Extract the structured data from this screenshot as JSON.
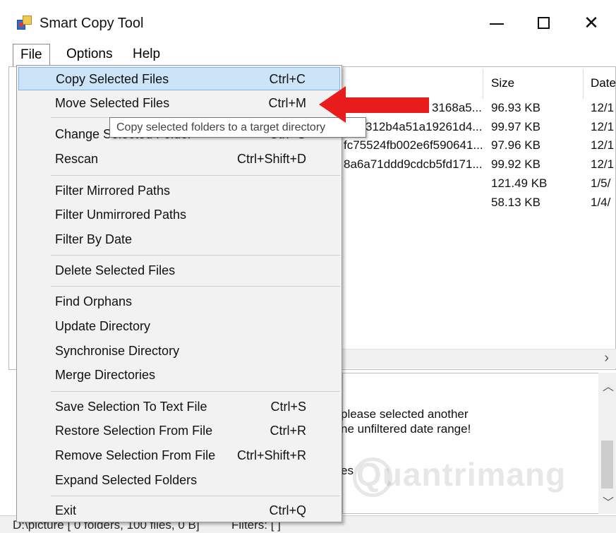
{
  "window": {
    "title": "Smart Copy Tool"
  },
  "menubar": {
    "file": "File",
    "options": "Options",
    "help": "Help"
  },
  "list": {
    "columns": {
      "size": "Size",
      "date": "Date"
    },
    "rows": [
      {
        "name": "3168a5...",
        "size": "96.93 KB",
        "date": "12/1"
      },
      {
        "name": "312b4a51a19261d4...",
        "size": "99.97 KB",
        "date": "12/1"
      },
      {
        "name": "fc75524fb002e6f590641...",
        "size": "97.96 KB",
        "date": "12/1"
      },
      {
        "name": "8a6a71ddd9cdcb5fd171...",
        "size": "99.92 KB",
        "date": "12/1"
      },
      {
        "name": "",
        "size": "121.49 KB",
        "date": "1/5/"
      },
      {
        "name": "",
        "size": "58.13 KB",
        "date": "1/4/"
      }
    ]
  },
  "log": {
    "line1": "please selected another",
    "line2": "ne unfiltered date range!",
    "line3": "es"
  },
  "status": {
    "path": "D:\\picture [ 0 folders, 100 files, 0 B]",
    "filters": "Filters: [ ]"
  },
  "watermark": "Quantrimang",
  "file_menu": {
    "items": [
      {
        "label": "Copy Selected Files",
        "shortcut": "Ctrl+C"
      },
      {
        "label": "Move Selected Files",
        "shortcut": "Ctrl+M"
      },
      {
        "label": "Change Selected Folder",
        "shortcut": "Ctrl+G"
      },
      {
        "label": "Rescan",
        "shortcut": "Ctrl+Shift+D"
      },
      {
        "label": "Filter Mirrored Paths",
        "shortcut": ""
      },
      {
        "label": "Filter Unmirrored Paths",
        "shortcut": ""
      },
      {
        "label": "Filter By Date",
        "shortcut": ""
      },
      {
        "label": "Delete Selected Files",
        "shortcut": ""
      },
      {
        "label": "Find Orphans",
        "shortcut": ""
      },
      {
        "label": "Update Directory",
        "shortcut": ""
      },
      {
        "label": "Synchronise Directory",
        "shortcut": ""
      },
      {
        "label": "Merge Directories",
        "shortcut": ""
      },
      {
        "label": "Save Selection To Text File",
        "shortcut": "Ctrl+S"
      },
      {
        "label": "Restore Selection From File",
        "shortcut": "Ctrl+R"
      },
      {
        "label": "Remove Selection From File",
        "shortcut": "Ctrl+Shift+R"
      },
      {
        "label": "Expand Selected Folders",
        "shortcut": ""
      },
      {
        "label": "Exit",
        "shortcut": "Ctrl+Q"
      }
    ]
  },
  "tooltip": "Copy selected folders to a target directory",
  "colors": {
    "highlight": "#cce4f7",
    "highlight_border": "#7eb4ea",
    "arrow": "#e81c1c",
    "menu_bg": "#f2f2f2"
  },
  "icons": {
    "app": "app-icon",
    "minimize": "minimize-icon",
    "maximize": "maximize-icon",
    "close": "close-icon",
    "arrow": "red-arrow-icon"
  }
}
